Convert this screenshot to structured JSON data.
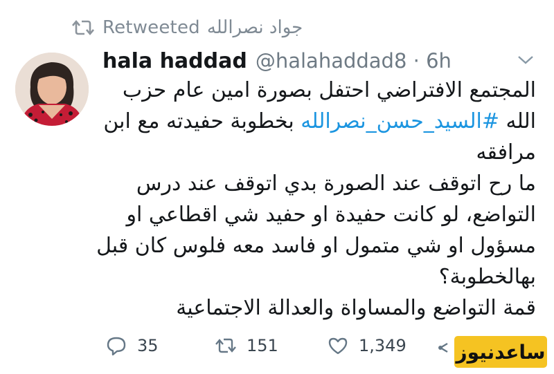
{
  "retweet": {
    "icon": "retweet-icon",
    "label": "Retweeted",
    "by": "جواد نصرالله"
  },
  "tweet": {
    "author_name": "hala haddad",
    "handle_time": "@halahaddad8 · 6h",
    "avatar_icon": "profile-photo",
    "menu_icon": "chevron-down-icon",
    "lines": [
      {
        "text": "المجتمع الافتراضي احتفل بصورة امين عام حزب"
      },
      {
        "before": "الله ",
        "hashtag": "#السيد_حسن_نصرالله",
        "after": " بخطوبة حفيدته مع ابن"
      },
      {
        "text": "مرافقه"
      },
      {
        "text": "ما رح اتوقف عند الصورة بدي اتوقف عند درس"
      },
      {
        "text": "التواضع، لو كانت حفيدة او حفيد شي اقطاعي او"
      },
      {
        "text": "مسؤول او شي متمول او فاسد معه فلوس كان قبل"
      },
      {
        "text": "بهالخطوبة؟"
      },
      {
        "text": "قمة التواضع والمساواة والعدالة الاجتماعية"
      }
    ],
    "hashtag_color": "#1b95e0"
  },
  "actions": {
    "reply": {
      "icon": "reply-icon",
      "count": "35"
    },
    "retweet": {
      "icon": "retweet-icon",
      "count": "151"
    },
    "like": {
      "icon": "heart-icon",
      "count": "1,349"
    },
    "share_icon": "share-icon"
  },
  "watermark": {
    "logo_text": "ساعدنیوز",
    "color": "#f5c322"
  }
}
